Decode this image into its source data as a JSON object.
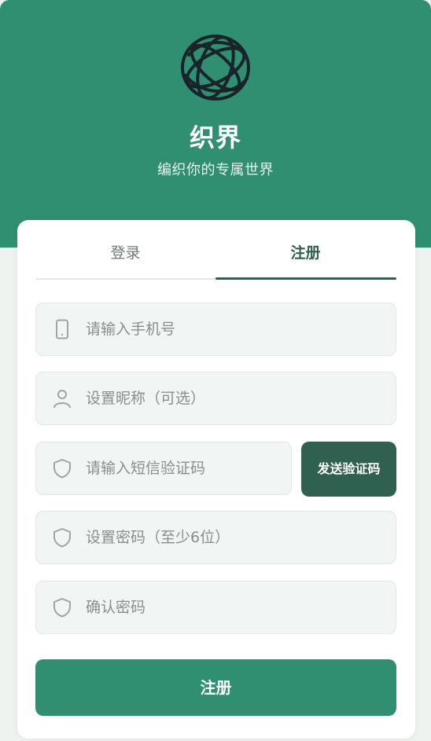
{
  "brand": {
    "title": "织界",
    "subtitle": "编织你的专属世界",
    "logo_icon": "globe-icon"
  },
  "tabs": [
    {
      "label": "登录",
      "active": false
    },
    {
      "label": "注册",
      "active": true
    }
  ],
  "form": {
    "phone": {
      "placeholder": "请输入手机号",
      "icon": "phone-icon"
    },
    "nickname": {
      "placeholder": "设置昵称（可选）",
      "icon": "user-icon"
    },
    "sms_code": {
      "placeholder": "请输入短信验证码",
      "icon": "shield-icon"
    },
    "password": {
      "placeholder": "设置密码（至少6位）",
      "icon": "shield-icon"
    },
    "confirm_password": {
      "placeholder": "确认密码",
      "icon": "shield-icon"
    },
    "send_code_label": "发送验证码",
    "submit_label": "注册"
  },
  "colors": {
    "hero": "#2f8f70",
    "primary_dark": "#2f6050",
    "submit": "#2f8f70",
    "background": "#eef3f0"
  }
}
